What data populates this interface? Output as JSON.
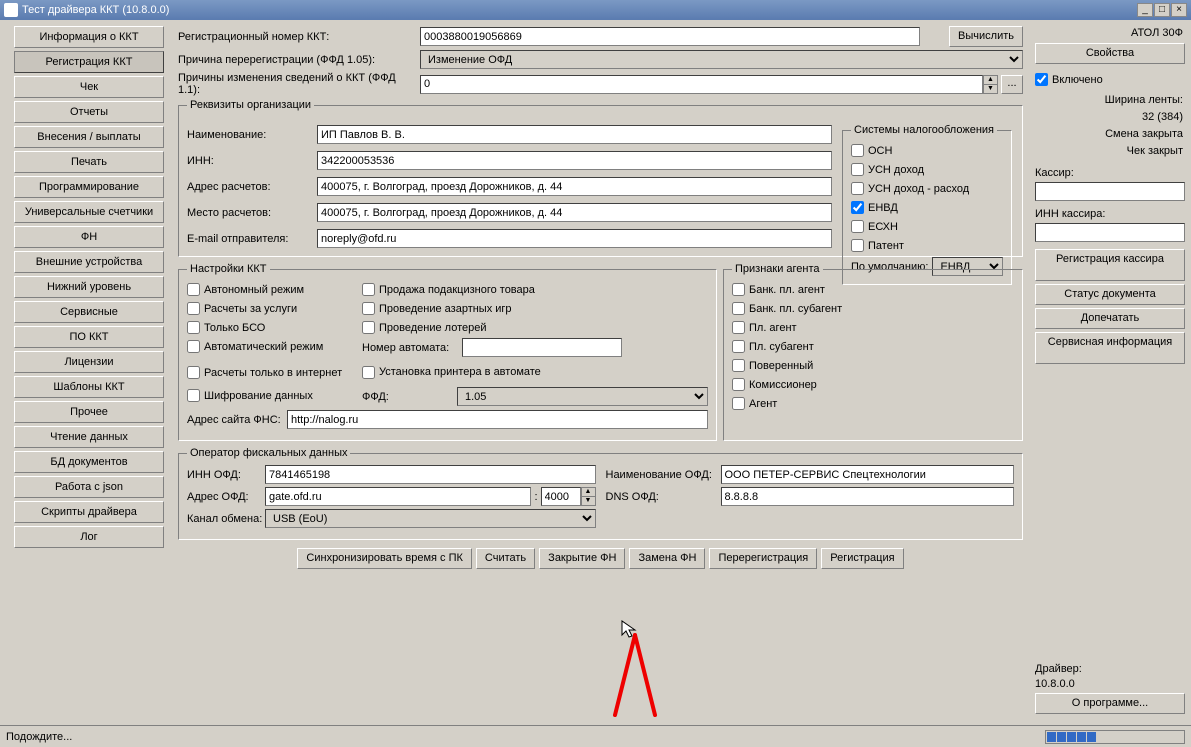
{
  "title": "Тест драйвера ККТ (10.8.0.0)",
  "nav": [
    "Информация о ККТ",
    "Регистрация ККТ",
    "Чек",
    "Отчеты",
    "Внесения / выплаты",
    "Печать",
    "Программирование",
    "Универсальные счетчики",
    "ФН",
    "Внешние устройства",
    "Нижний уровень",
    "Сервисные",
    "ПО ККТ",
    "Лицензии",
    "Шаблоны ККТ",
    "Прочее",
    "Чтение данных",
    "БД документов",
    "Работа с json",
    "Скрипты драйвера",
    "Лог"
  ],
  "reg": {
    "rn_lbl": "Регистрационный номер ККТ:",
    "rn": "0003880019056869",
    "calc": "Вычислить",
    "rr_lbl": "Причина перерегистрации (ФФД 1.05):",
    "rr": "Изменение ОФД",
    "ri_lbl": "Причины изменения сведений о ККТ (ФФД 1.1):",
    "ri": "0"
  },
  "org": {
    "legend": "Реквизиты организации",
    "name_l": "Наименование:",
    "name": "ИП Павлов В. В.",
    "inn_l": "ИНН:",
    "inn": "342200053536",
    "addr_l": "Адрес расчетов:",
    "addr": "400075, г. Волгоград, проезд Дорожников, д. 44",
    "place_l": "Место расчетов:",
    "place": "400075, г. Волгоград, проезд Дорожников, д. 44",
    "email_l": "E-mail отправителя:",
    "email": "noreply@ofd.ru"
  },
  "tax": {
    "legend": "Системы налогообложения",
    "items": [
      "ОСН",
      "УСН доход",
      "УСН доход - расход",
      "ЕНВД",
      "ЕСХН",
      "Патент"
    ],
    "def_l": "По умолчанию:",
    "def": "ЕНВД"
  },
  "kkt": {
    "legend": "Настройки ККТ",
    "c1": [
      "Автономный режим",
      "Расчеты за услуги",
      "Только БСО",
      "Автоматический режим"
    ],
    "c2": [
      "Продажа подакцизного товара",
      "Проведение азартных игр",
      "Проведение лотерей"
    ],
    "na_l": "Номер автомата:",
    "na": "",
    "c3": "Расчеты только в интернет",
    "c4": "Установка принтера в автомате",
    "enc": "Шифрование данных",
    "ffd_l": "ФФД:",
    "ffd": "1.05",
    "fns_l": "Адрес сайта ФНС:",
    "fns": "http://nalog.ru"
  },
  "agent": {
    "legend": "Признаки агента",
    "items": [
      "Банк. пл. агент",
      "Банк. пл. субагент",
      "Пл. агент",
      "Пл. субагент",
      "Поверенный",
      "Комиссионер",
      "Агент"
    ]
  },
  "ofd": {
    "legend": "Оператор фискальных данных",
    "inn_l": "ИНН ОФД:",
    "inn": "7841465198",
    "name_l": "Наименование ОФД:",
    "name": "ООО ПЕТЕР-СЕРВИС Спецтехнологии",
    "addr_l": "Адрес ОФД:",
    "addr": "gate.ofd.ru",
    "port": "4000",
    "dns_l": "DNS ОФД:",
    "dns": "8.8.8.8",
    "ch_l": "Канал обмена:",
    "ch": "USB (EoU)"
  },
  "foot": [
    "Синхронизировать время с ПК",
    "Считать",
    "Закрытие ФН",
    "Замена ФН",
    "Перерегистрация",
    "Регистрация"
  ],
  "rp": {
    "model": "АТОЛ 30Ф",
    "props": "Свойства",
    "enabled": "Включено",
    "tape_l": "Ширина ленты:",
    "tape": "32 (384)",
    "shift": "Смена закрыта",
    "chk": "Чек закрыт",
    "cashier_l": "Кассир:",
    "cinn_l": "ИНН кассира:",
    "regk": "Регистрация кассира",
    "docst": "Статус документа",
    "doprint": "Допечатать",
    "svc": "Сервисная информация",
    "drv_l": "Драйвер:",
    "drv": "10.8.0.0",
    "about": "О программе..."
  },
  "status": "Подождите..."
}
